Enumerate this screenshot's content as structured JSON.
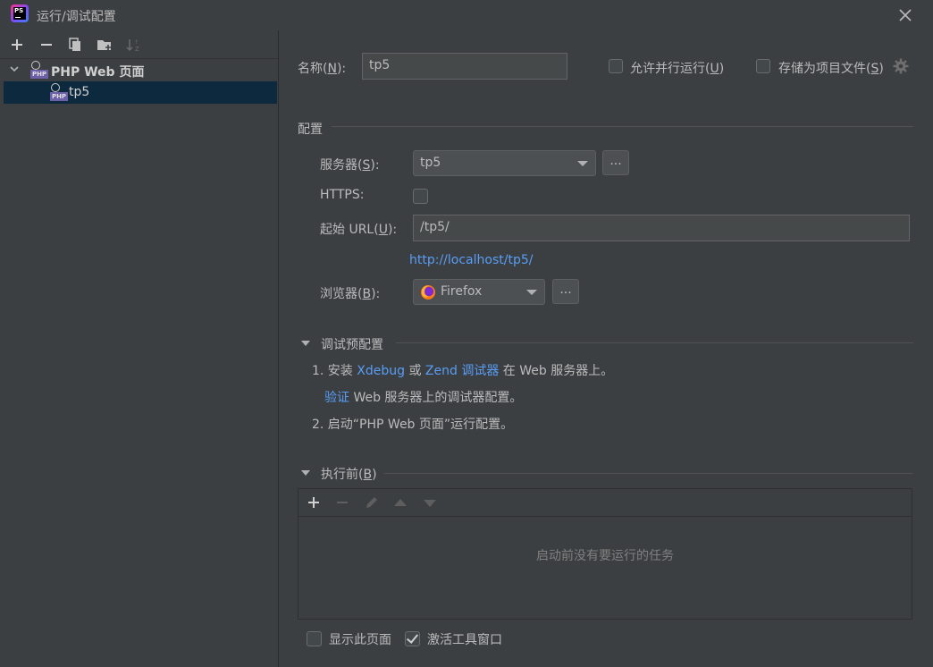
{
  "window": {
    "title": "运行/调试配置",
    "app_icon_text": "PS"
  },
  "tree": {
    "group_label": "PHP Web 页面",
    "item_label": "tp5",
    "icon_tag": "PHP"
  },
  "form": {
    "name_label_prefix": "名称(",
    "name_label_key": "N",
    "name_label_suffix": "):",
    "name_value": "tp5",
    "allow_parallel_prefix": "允许并行运行(",
    "allow_parallel_key": "U",
    "allow_parallel_suffix": ")",
    "store_as_file_prefix": "存储为项目文件(",
    "store_as_file_key": "S",
    "store_as_file_suffix": ")"
  },
  "config": {
    "section_title": "配置",
    "server_label_prefix": "服务器(",
    "server_label_key": "S",
    "server_label_suffix": "):",
    "server_value": "tp5",
    "https_label": "HTTPS:",
    "start_url_label_prefix": "起始 URL(",
    "start_url_label_key": "U",
    "start_url_label_suffix": "):",
    "start_url_value": "/tp5/",
    "resolved_url": "http://localhost/tp5/",
    "browser_label_prefix": "浏览器(",
    "browser_label_key": "B",
    "browser_label_suffix": "):",
    "browser_value": "Firefox",
    "more_button": "..."
  },
  "debug": {
    "section_title": "调试预配置",
    "step1_prefix": "1. 安装 ",
    "xdebug_link": "Xdebug",
    "or_text": " 或 ",
    "zend_link": "Zend 调试器",
    "step1_suffix": " 在 Web 服务器上。",
    "verify_link": "验证",
    "verify_suffix": " Web 服务器上的调试器配置。",
    "step2": "2. 启动“PHP Web 页面”运行配置。"
  },
  "before_launch": {
    "section_title_prefix": "执行前(",
    "section_title_key": "B",
    "section_title_suffix": ")",
    "empty_text": "启动前没有要运行的任务"
  },
  "footer": {
    "show_page_label": "显示此页面",
    "activate_tool_label": "激活工具窗口",
    "show_page_checked": false,
    "activate_tool_checked": true
  },
  "colors": {
    "background": "#3c3f41",
    "selection": "#0d293e",
    "link": "#589df6",
    "text": "#bbbbbb"
  }
}
